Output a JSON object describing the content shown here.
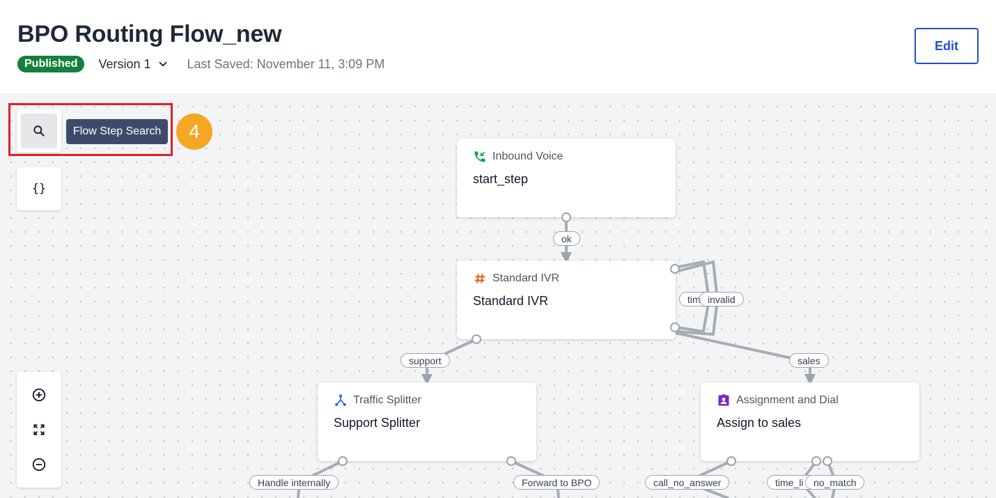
{
  "header": {
    "title": "BPO Routing Flow_new",
    "status_badge": "Published",
    "version_label": "Version 1",
    "last_saved": "Last Saved: November 11, 3:09 PM",
    "edit_label": "Edit"
  },
  "toolbar": {
    "search_tooltip": "Flow Step Search",
    "variables_label": "{}",
    "step_number": "4"
  },
  "nodes": {
    "inbound": {
      "type": "Inbound Voice",
      "name": "start_step"
    },
    "ivr": {
      "type": "Standard IVR",
      "name": "Standard IVR"
    },
    "splitter": {
      "type": "Traffic Splitter",
      "name": "Support Splitter"
    },
    "assign": {
      "type": "Assignment and Dial",
      "name": "Assign to sales"
    }
  },
  "edges": {
    "ok": "ok",
    "support": "support",
    "sales": "sales",
    "timeout_partial": "tim",
    "invalid": "invalid",
    "handle_internally": "Handle internally",
    "forward_to_bpo": "Forward to BPO",
    "call_no_answer": "call_no_answer",
    "time_limit_partial": "time_li",
    "no_match": "no_match"
  },
  "colors": {
    "accent": "#1d4ed8",
    "published": "#15803d",
    "highlight": "#e11d2a",
    "step_badge": "#f5a623",
    "tooltip_bg": "#3f4a6b",
    "inbound_icon": "#16a34a",
    "ivr_icon": "#ea580c",
    "splitter_icon": "#2563eb",
    "assign_icon": "#7e22ce"
  },
  "icons": {
    "search": "search-icon",
    "zoom_in": "zoom-in-icon",
    "fit": "fit-view-icon",
    "zoom_out": "zoom-out-icon",
    "version": "chevron-down-icon",
    "inbound": "phone-incoming-icon",
    "ivr": "hash-icon",
    "splitter": "split-icon",
    "assign": "contact-badge-icon"
  }
}
